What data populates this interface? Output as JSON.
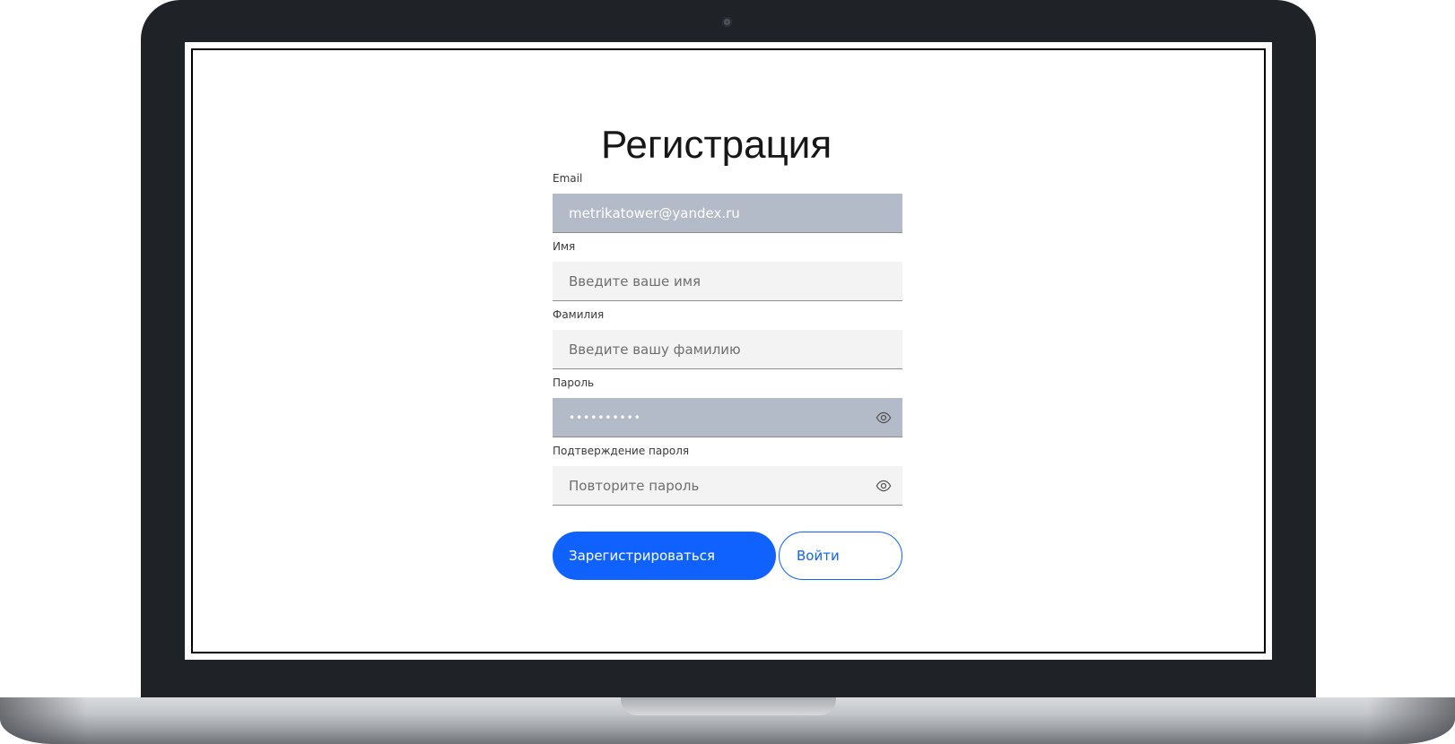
{
  "page": {
    "title": "Регистрация"
  },
  "fields": {
    "email": {
      "label": "Email",
      "value": "metrikatower@yandex.ru"
    },
    "first_name": {
      "label": "Имя",
      "placeholder": "Введите ваше имя"
    },
    "last_name": {
      "label": "Фамилия",
      "placeholder": "Введите вашу фамилию"
    },
    "password": {
      "label": "Пароль",
      "masked_value": "••••••••••",
      "toggle_icon": "eye-icon"
    },
    "password_confirm": {
      "label": "Подтверждение пароля",
      "placeholder": "Повторите пароль",
      "toggle_icon": "eye-icon"
    }
  },
  "actions": {
    "register_label": "Зарегистрироваться",
    "login_label": "Войти"
  },
  "colors": {
    "primary": "#0f62fe",
    "filled_input": "#b4bbc8",
    "empty_input": "#f3f3f3",
    "bezel": "#1f2226"
  }
}
